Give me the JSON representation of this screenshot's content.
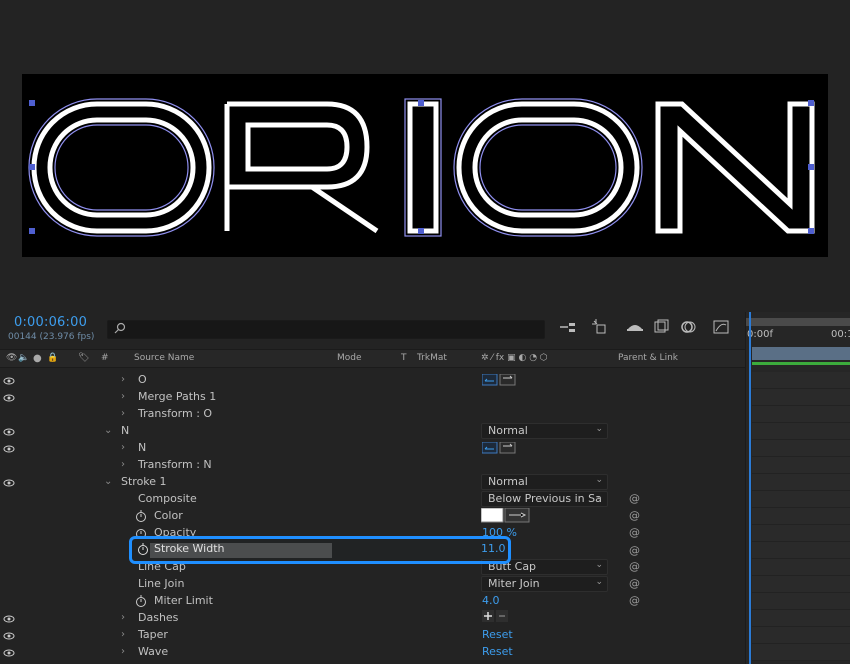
{
  "composition": {
    "text": "ORION"
  },
  "timeline": {
    "timecode": "0:00:06:00",
    "frames": "00144 (23.976 fps)",
    "search_placeholder": "",
    "columns": {
      "hash": "#",
      "source_name": "Source Name",
      "mode": "Mode",
      "t": "T",
      "trkmat": "TrkMat",
      "parent_link": "Parent & Link"
    },
    "ruler": {
      "start": "0:00f",
      "next": "00:1"
    },
    "rows": [
      {
        "label": "O",
        "kind": "path"
      },
      {
        "label": "Merge Paths 1"
      },
      {
        "label": "Transform : O"
      },
      {
        "label": "N",
        "mode": "Normal"
      },
      {
        "label": "N",
        "kind": "path"
      },
      {
        "label": "Transform : N"
      },
      {
        "label": "Stroke 1",
        "mode": "Normal"
      },
      {
        "label": "Composite",
        "value": "Below Previous in Sa"
      },
      {
        "label": "Color"
      },
      {
        "label": "Opacity",
        "value": "100 %"
      },
      {
        "label": "Stroke Width",
        "value": "11.0"
      },
      {
        "label": "Line Cap",
        "value": "Butt Cap"
      },
      {
        "label": "Line Join",
        "value": "Miter Join"
      },
      {
        "label": "Miter Limit",
        "value": "4.0"
      },
      {
        "label": "Dashes"
      },
      {
        "label": "Taper",
        "value": "Reset"
      },
      {
        "label": "Wave",
        "value": "Reset"
      }
    ]
  },
  "colors": {
    "accent": "#1f8fff",
    "timecode": "#3d9ded",
    "stroke_outline": "#b8b8ff"
  }
}
